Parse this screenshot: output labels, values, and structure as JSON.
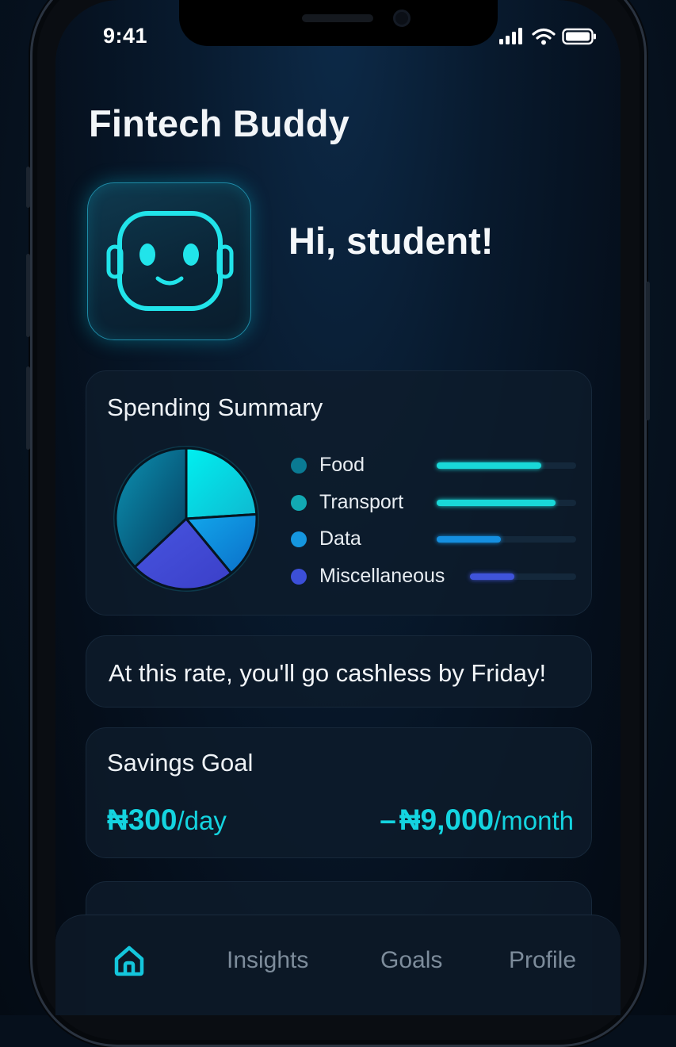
{
  "status_bar": {
    "time": "9:41"
  },
  "header": {
    "title": "Fintech Buddy"
  },
  "greeting": {
    "text": "Hi, student!",
    "avatar_icon": "robot-face-icon"
  },
  "spending_summary": {
    "title": "Spending Summary",
    "categories": [
      {
        "label": "Food",
        "color": "#0a7a93",
        "bar_color": "#19d8d8",
        "bar_fraction": 0.75
      },
      {
        "label": "Transport",
        "color": "#12a9b3",
        "bar_color": "#19d8d8",
        "bar_fraction": 0.85
      },
      {
        "label": "Data",
        "color": "#1596df",
        "bar_color": "#158fe0",
        "bar_fraction": 0.46
      },
      {
        "label": "Miscellaneous",
        "color": "#3c4fd8",
        "bar_color": "#3f53da",
        "bar_fraction": 0.42
      }
    ],
    "pie_shares": [
      {
        "label": "Food",
        "value": 37,
        "color_start": "#0b93b3",
        "color_end": "#063a5c"
      },
      {
        "label": "Transport",
        "value": 24,
        "color_start": "#00f0f0",
        "color_end": "#0fb8d0"
      },
      {
        "label": "Data",
        "value": 15,
        "color_start": "#12a8ec",
        "color_end": "#0b6ec8"
      },
      {
        "label": "Miscellaneous",
        "value": 24,
        "color_start": "#4755e0",
        "color_end": "#3b3fc8"
      }
    ]
  },
  "tip": {
    "text": "At this rate, you'll go cashless by Friday!"
  },
  "savings_goal": {
    "title": "Savings Goal",
    "daily_amount": "₦300",
    "daily_unit": "/day",
    "monthly_prefix": "–",
    "monthly_amount": "₦9,000",
    "monthly_unit": "/month"
  },
  "nav": {
    "home_icon": "home-icon",
    "insights": "Insights",
    "goals": "Goals",
    "profile": "Profile"
  },
  "colors": {
    "accent": "#14d4e0",
    "background": "#050f1c"
  }
}
